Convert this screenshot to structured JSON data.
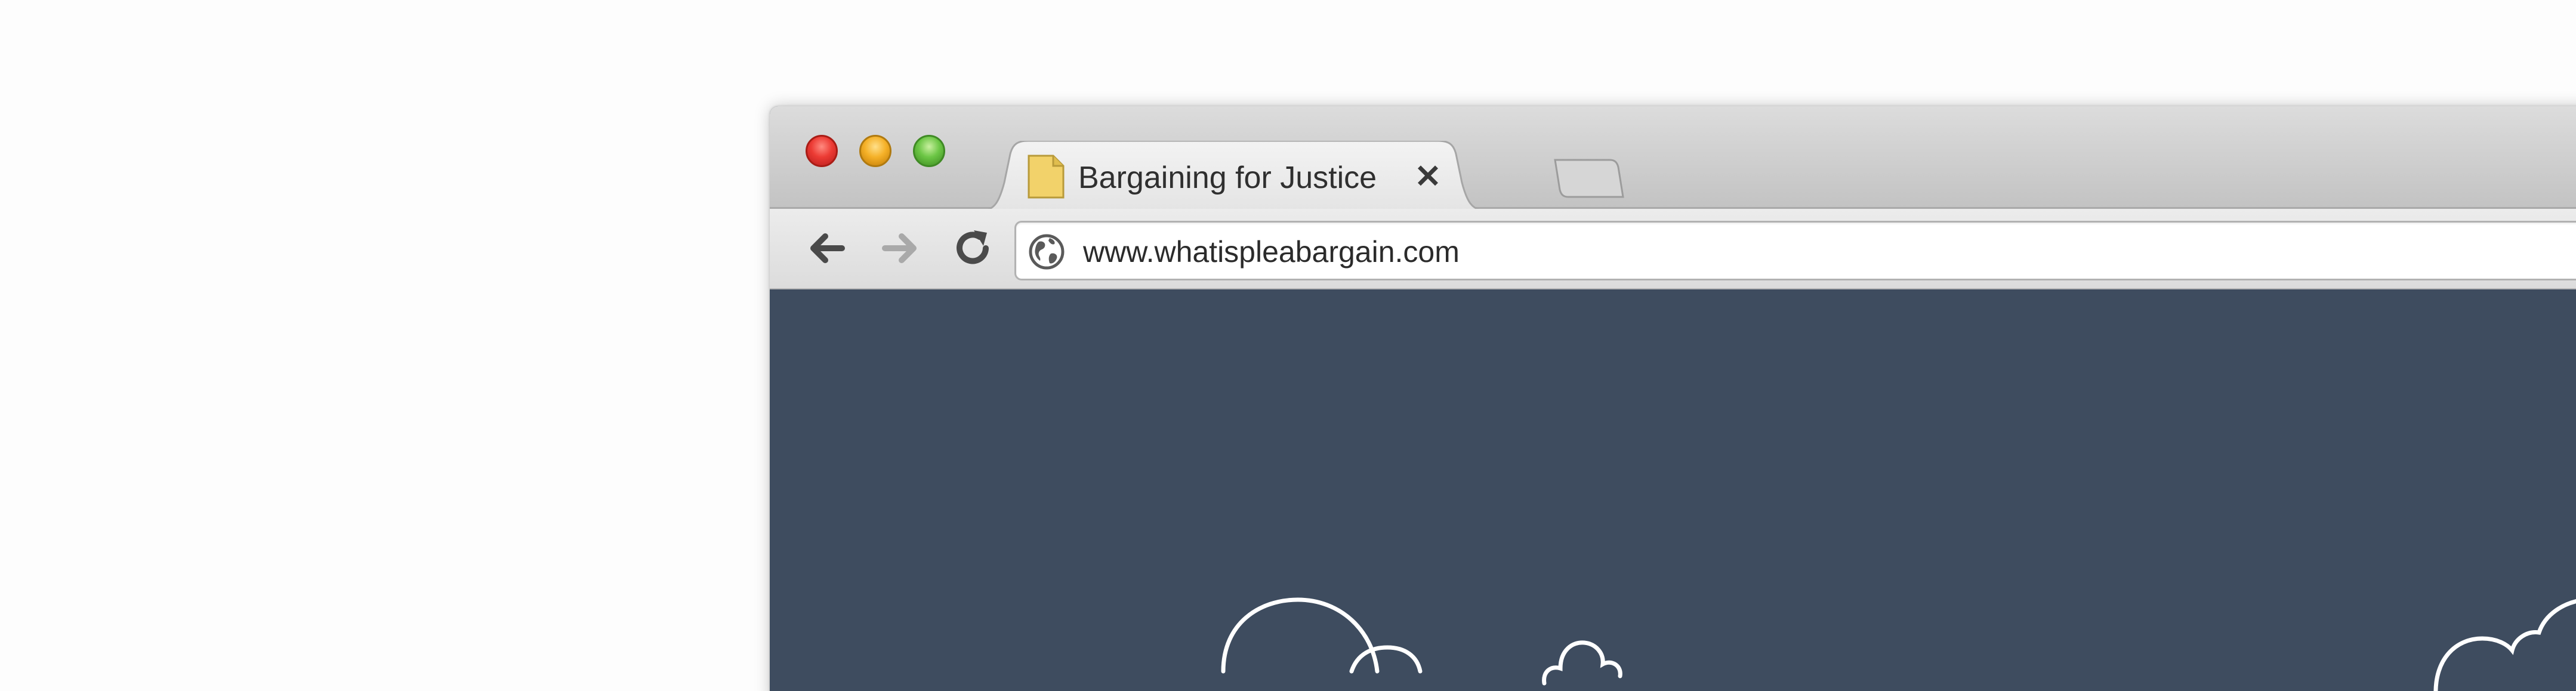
{
  "window": {
    "controls": [
      "close",
      "minimize",
      "maximize"
    ]
  },
  "tab": {
    "title": "Bargaining for Justice",
    "close_glyph": "✕",
    "favicon": "document-icon"
  },
  "toolbar": {
    "back_icon": "arrow-left-icon",
    "forward_icon": "arrow-right-icon",
    "reload_icon": "reload-icon"
  },
  "address_bar": {
    "url": "www.whatispleabargain.com",
    "icon": "globe-icon"
  },
  "colors": {
    "content_background": "#3e4c5f",
    "favicon_fill": "#f2d26a",
    "close_red": "#ec3b34",
    "minimize_yellow": "#f5b128",
    "maximize_green": "#6cc645"
  }
}
